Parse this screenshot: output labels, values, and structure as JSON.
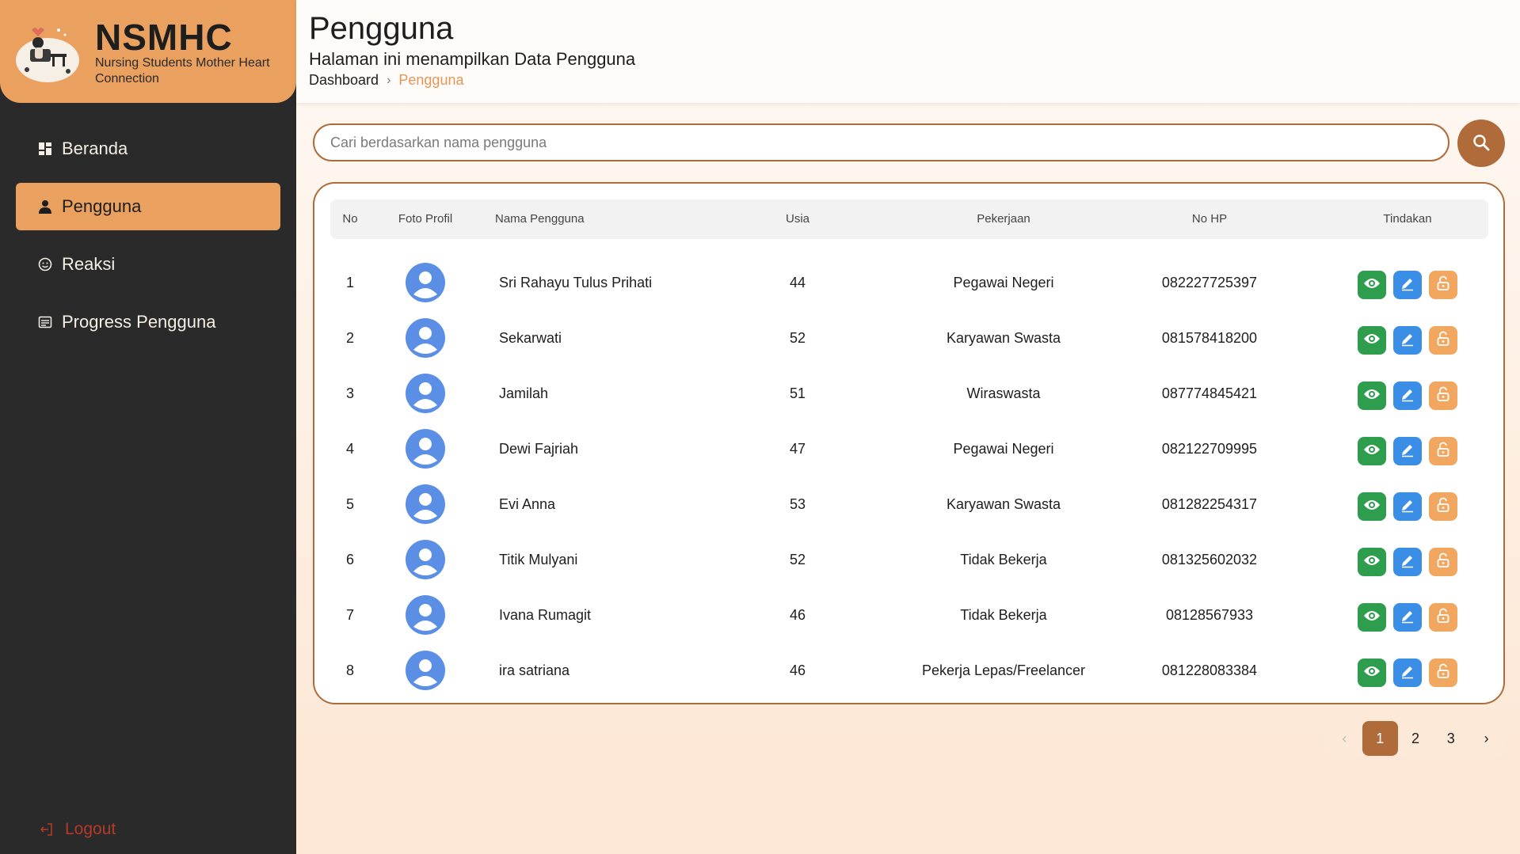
{
  "brand": {
    "title": "NSMHC",
    "subtitle": "Nursing Students Mother Heart Connection"
  },
  "nav": {
    "items": [
      {
        "label": "Beranda",
        "icon": "dashboard-icon"
      },
      {
        "label": "Pengguna",
        "icon": "user-icon",
        "active": true
      },
      {
        "label": "Reaksi",
        "icon": "reaction-icon"
      },
      {
        "label": "Progress Pengguna",
        "icon": "progress-icon"
      }
    ],
    "logout": "Logout"
  },
  "header": {
    "title": "Pengguna",
    "subtitle": "Halaman ini menampilkan Data Pengguna",
    "breadcrumb": {
      "root": "Dashboard",
      "current": "Pengguna"
    }
  },
  "search": {
    "placeholder": "Cari berdasarkan nama pengguna",
    "value": ""
  },
  "table": {
    "headers": {
      "no": "No",
      "photo": "Foto Profil",
      "name": "Nama Pengguna",
      "age": "Usia",
      "job": "Pekerjaan",
      "phone": "No HP",
      "actions": "Tindakan"
    },
    "rows": [
      {
        "no": "1",
        "name": "Sri Rahayu Tulus Prihati",
        "age": "44",
        "job": "Pegawai Negeri",
        "phone": "082227725397"
      },
      {
        "no": "2",
        "name": "Sekarwati",
        "age": "52",
        "job": "Karyawan Swasta",
        "phone": "081578418200"
      },
      {
        "no": "3",
        "name": "Jamilah",
        "age": "51",
        "job": "Wiraswasta",
        "phone": "087774845421"
      },
      {
        "no": "4",
        "name": "Dewi Fajriah",
        "age": "47",
        "job": "Pegawai Negeri",
        "phone": "082122709995"
      },
      {
        "no": "5",
        "name": "Evi Anna",
        "age": "53",
        "job": "Karyawan Swasta",
        "phone": "081282254317"
      },
      {
        "no": "6",
        "name": "Titik Mulyani",
        "age": "52",
        "job": "Tidak Bekerja",
        "phone": "081325602032"
      },
      {
        "no": "7",
        "name": "Ivana Rumagit",
        "age": "46",
        "job": "Tidak Bekerja",
        "phone": "08128567933"
      },
      {
        "no": "8",
        "name": "ira satriana",
        "age": "46",
        "job": "Pekerja Lepas/Freelancer",
        "phone": "081228083384"
      }
    ]
  },
  "pagination": {
    "prev": "‹",
    "pages": [
      "1",
      "2",
      "3"
    ],
    "current": "1",
    "next": "›"
  },
  "colors": {
    "accent": "#eaa05f",
    "brown": "#b06b3a",
    "sidebar": "#2a2a2a",
    "view": "#2e9e4e",
    "edit": "#3a8ee6",
    "lock": "#f2a760",
    "logout": "#b43a2a"
  }
}
